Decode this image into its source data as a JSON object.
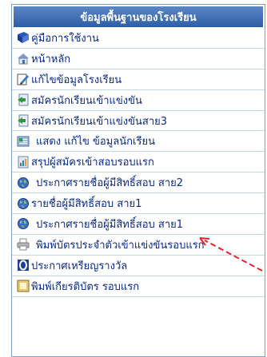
{
  "menu": {
    "header": "ข้อมูลพื้นฐานของโรงเรียน",
    "items": [
      {
        "label": "คู่มือการใช้งาน",
        "icon": "book-icon"
      },
      {
        "label": "หน้าหลัก",
        "icon": "home-icon"
      },
      {
        "label": "แก้ไขข้อมูลโรงเรียน",
        "icon": "edit-icon"
      },
      {
        "label": "สมัครนักเรียนเข้าแข่งขัน",
        "icon": "register-icon"
      },
      {
        "label": "สมัครนักเรียนเข้าแข่งขันสาย3",
        "icon": "register-icon"
      },
      {
        "label": "แสดง แก้ไข ข้อมูลนักเรียน",
        "icon": "student-list-icon"
      },
      {
        "label": "สรุปผู้สมัครเข้าสอบรอบแรก",
        "icon": "summary-icon"
      },
      {
        "label": "ประกาศรายชื่อผู้มีสิทธิ์สอบ สาย2",
        "icon": "globe-icon"
      },
      {
        "label": "รายชื่อผู้มีสิทธิ์สอบ สาย1",
        "icon": "globe-icon"
      },
      {
        "label": "ประกาศรายชื่อผู้มีสิทธิ์สอบ สาย1",
        "icon": "globe-icon"
      },
      {
        "label": "พิมพ์บัตรประจำตัวเข้าแข่งขันรอบแรก",
        "icon": "printer-icon"
      },
      {
        "label": "ประกาศเหรียญรางวัล",
        "icon": "medal-icon"
      },
      {
        "label": "พิมพ์เกียรติบัตร รอบแรก",
        "icon": "certificate-icon"
      }
    ]
  },
  "colors": {
    "header_bg": "#3a68b0",
    "link": "#0a2a8a",
    "arrow": "#e0262a"
  }
}
